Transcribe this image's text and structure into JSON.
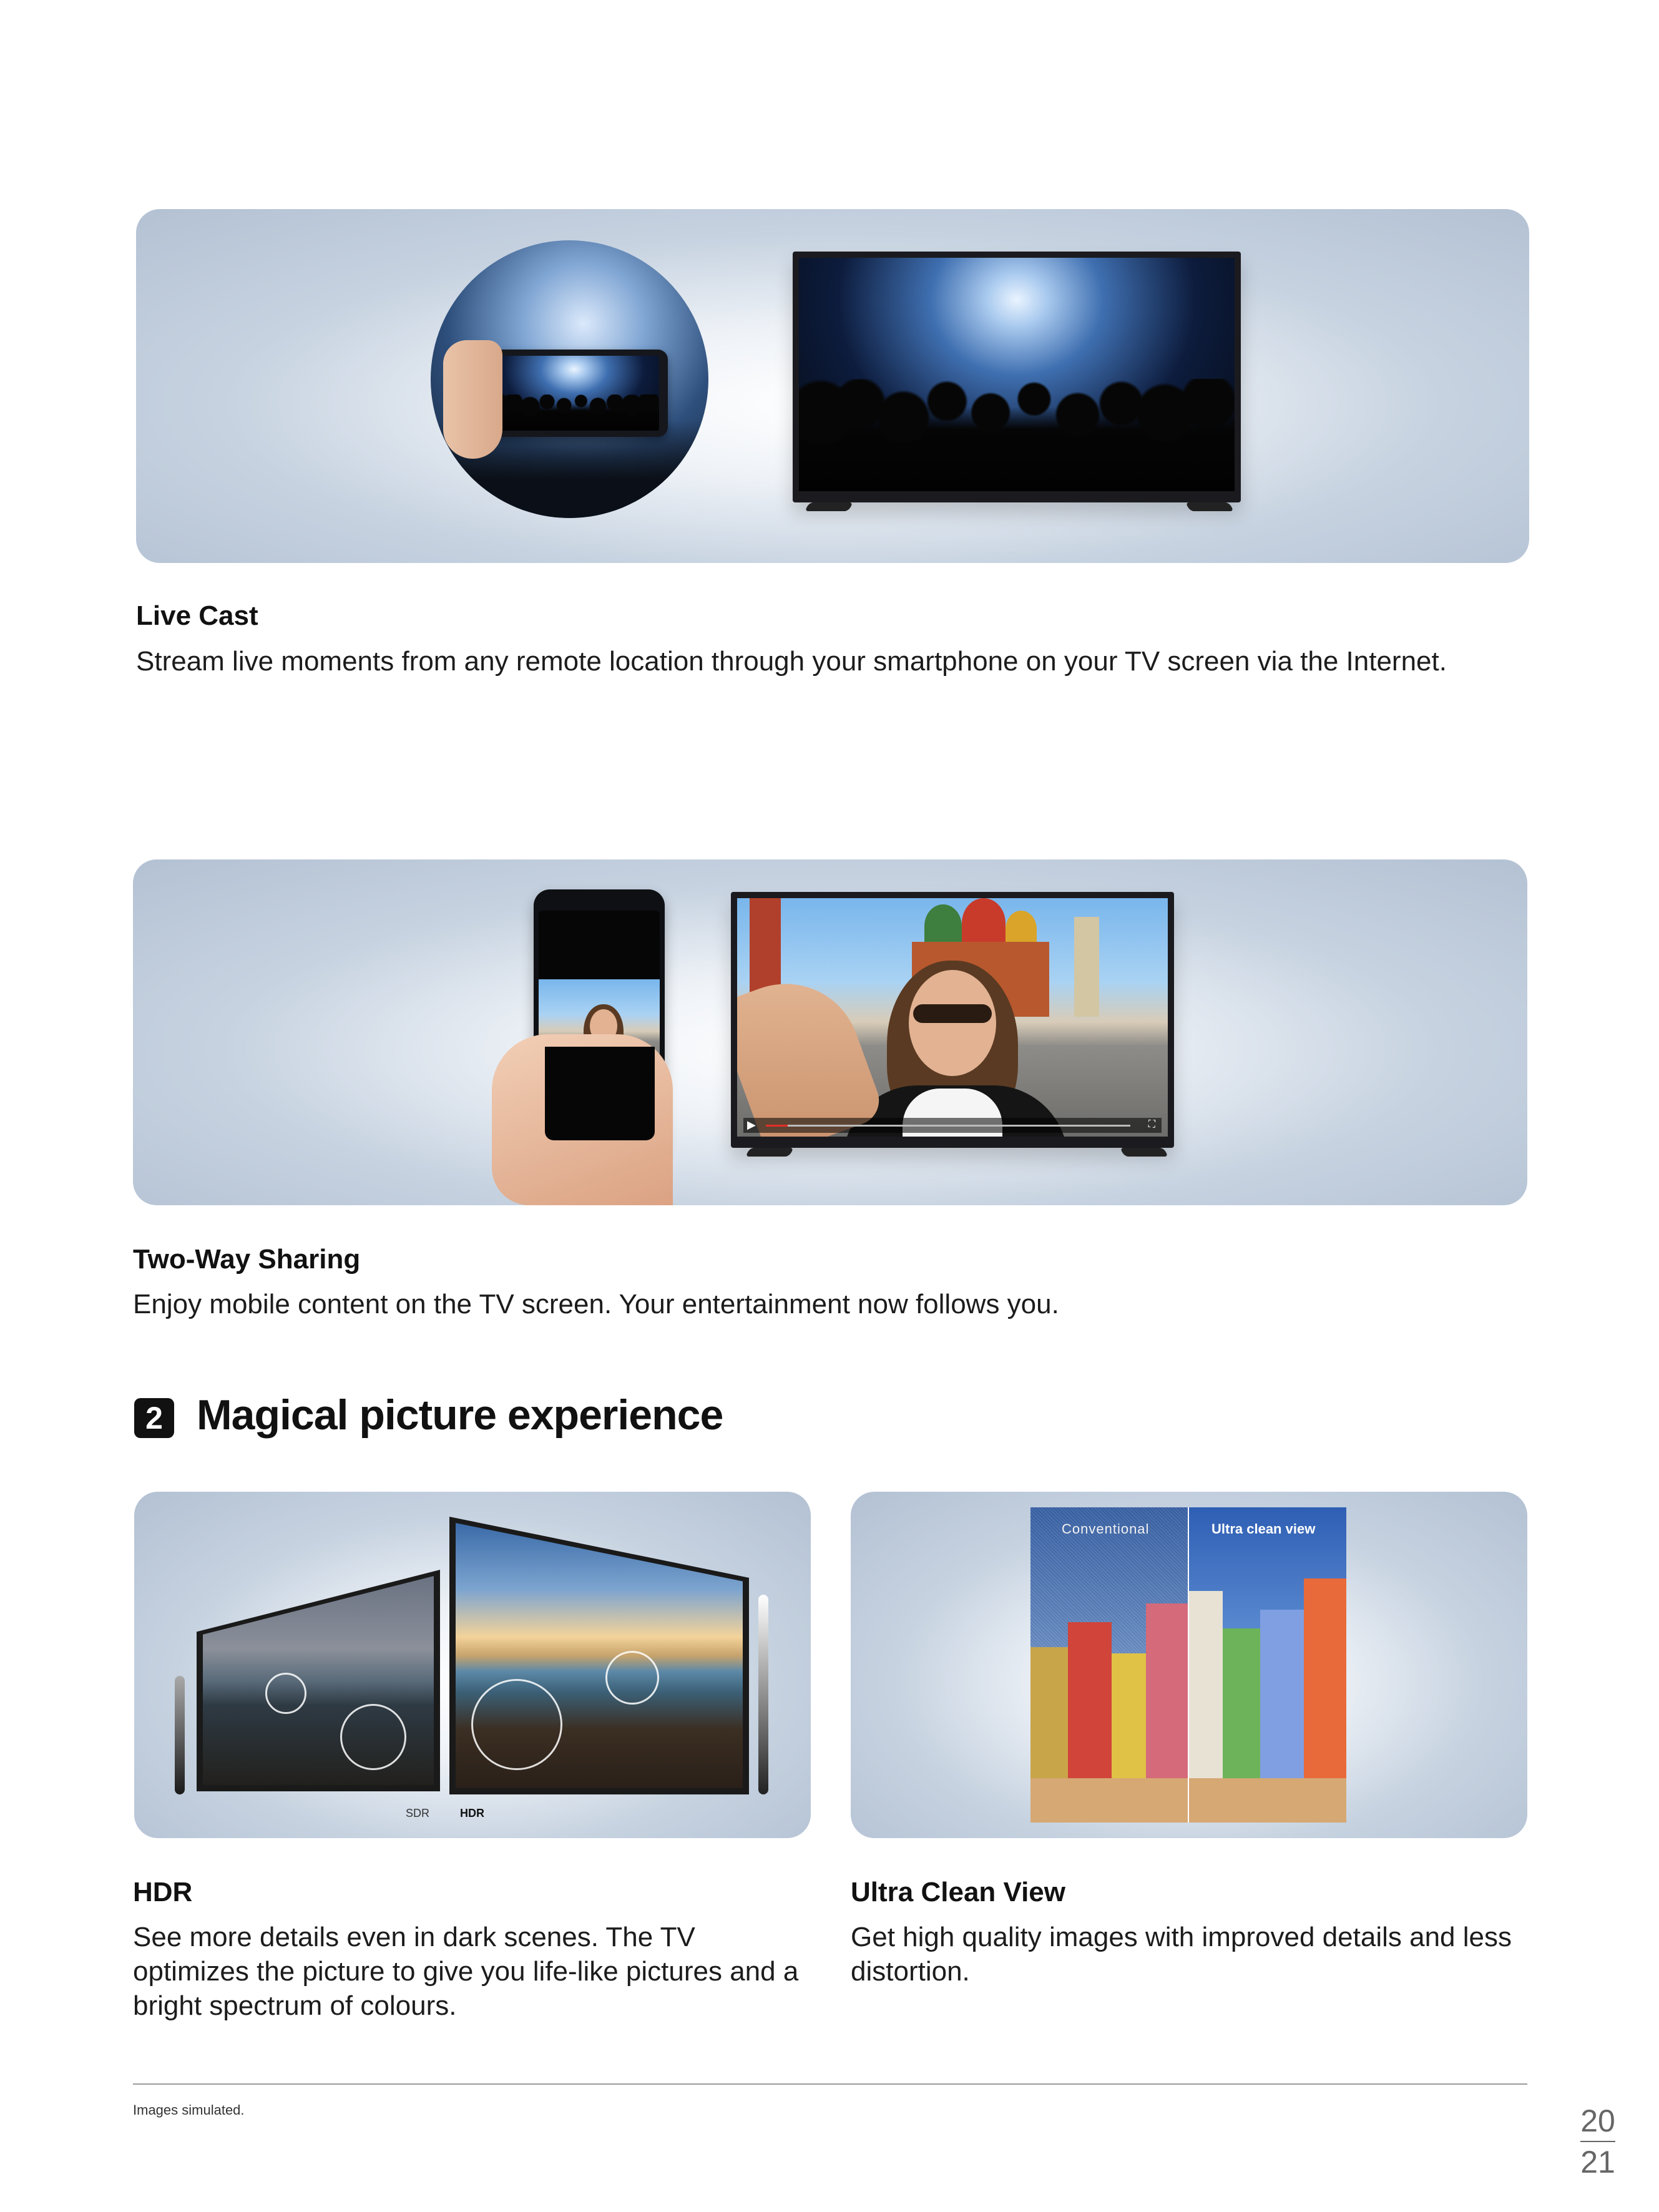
{
  "features": {
    "live_cast": {
      "title": "Live Cast",
      "desc": "Stream live moments from any remote location through your smartphone on your TV screen via the Internet."
    },
    "two_way": {
      "title": "Two-Way Sharing",
      "desc": "Enjoy mobile content on the TV screen. Your entertainment now follows you."
    },
    "hdr": {
      "title": "HDR",
      "desc": "See more details even in dark scenes. The TV optimizes the picture to give you life-like pictures and a bright spectrum of colours.",
      "label_sdr": "SDR",
      "label_hdr": "HDR"
    },
    "ultra_clean": {
      "title": "Ultra Clean View",
      "desc": "Get high quality images with improved details and less distortion.",
      "label_conventional": "Conventional",
      "label_ucv": "Ultra clean view"
    }
  },
  "section": {
    "number": "2",
    "title": "Magical picture experience"
  },
  "footer": {
    "note": "Images simulated.",
    "page_top": "20",
    "page_bottom": "21"
  }
}
